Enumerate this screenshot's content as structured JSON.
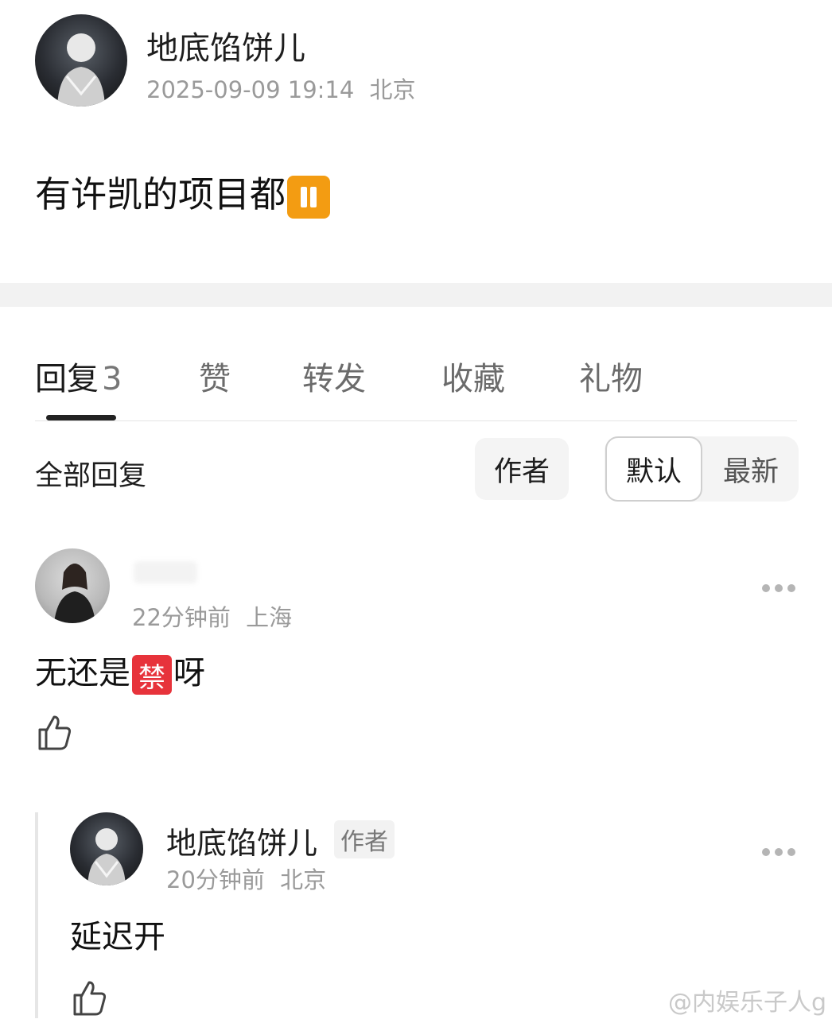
{
  "post": {
    "author_name": "地底馅饼儿",
    "timestamp": "2025-09-09 19:14",
    "location": "北京",
    "text": "有许凯的项目都",
    "emoji_icon": "pause-button-emoji"
  },
  "tabs": [
    {
      "label": "回复",
      "count": "3"
    },
    {
      "label": "赞"
    },
    {
      "label": "转发"
    },
    {
      "label": "收藏"
    },
    {
      "label": "礼物"
    }
  ],
  "filters": {
    "all_replies": "全部回复",
    "author": "作者",
    "sort_default": "默认",
    "sort_latest": "最新"
  },
  "comments": [
    {
      "time": "22分钟前",
      "location": "上海",
      "text_before": "无还是",
      "emoji_char": "禁",
      "text_after": "呀"
    },
    {
      "author_name": "地底馅饼儿",
      "author_badge": "作者",
      "time": "20分钟前",
      "location": "北京",
      "text": "延迟开"
    }
  ],
  "watermark": "@内娱乐子人g",
  "colors": {
    "emoji_pause": "#f39c12",
    "emoji_ban": "#e7333b",
    "divider": "#f2f2f2"
  }
}
